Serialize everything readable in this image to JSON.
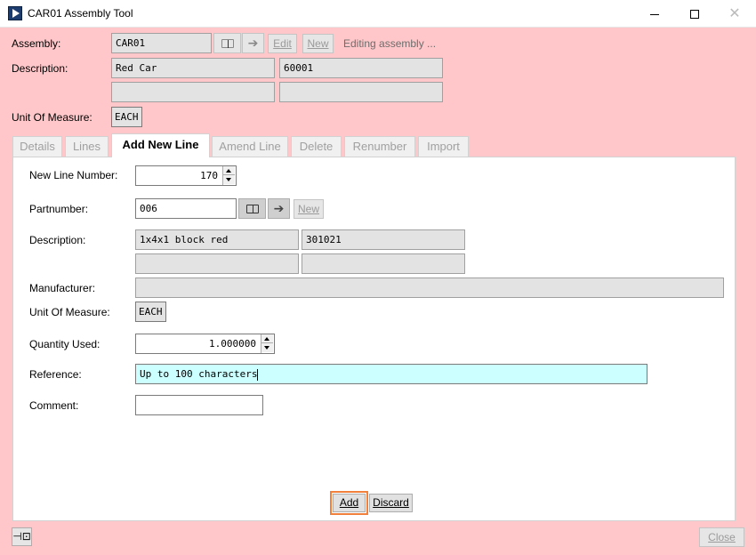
{
  "window": {
    "title": "CAR01 Assembly Tool"
  },
  "header": {
    "assembly_label": "Assembly:",
    "assembly_value": "CAR01",
    "edit_label": "Edit",
    "new_label": "New",
    "status": "Editing assembly ...",
    "description_label": "Description:",
    "description_1": "Red Car",
    "description_2": "60001",
    "description_3": "",
    "description_4": "",
    "uom_label": "Unit Of Measure:",
    "uom_value": "EACH"
  },
  "tabs": [
    {
      "label": "Details",
      "active": false
    },
    {
      "label": "Lines",
      "active": false
    },
    {
      "label": "Add New Line",
      "active": true
    },
    {
      "label": "Amend Line",
      "active": false
    },
    {
      "label": "Delete",
      "active": false
    },
    {
      "label": "Renumber",
      "active": false
    },
    {
      "label": "Import",
      "active": false
    }
  ],
  "form": {
    "line_number_label": "New Line Number:",
    "line_number_value": "170",
    "partnumber_label": "Partnumber:",
    "partnumber_value": "006",
    "new_label": "New",
    "description_label": "Description:",
    "description_1": "1x4x1 block red",
    "description_2": "301021",
    "description_3": "",
    "description_4": "",
    "manufacturer_label": "Manufacturer:",
    "manufacturer_value": "",
    "uom_label": "Unit Of Measure:",
    "uom_value": "EACH",
    "quantity_label": "Quantity Used:",
    "quantity_value": "1.000000",
    "reference_label": "Reference:",
    "reference_value": "Up to 100 characters",
    "comment_label": "Comment:",
    "comment_value": "",
    "add_label": "Add",
    "discard_label": "Discard"
  },
  "footer": {
    "close_label": "Close"
  },
  "icons": {
    "app": "play-icon",
    "lookup": "book-icon",
    "go": "arrow-right-icon",
    "pin": "pin-icon"
  }
}
